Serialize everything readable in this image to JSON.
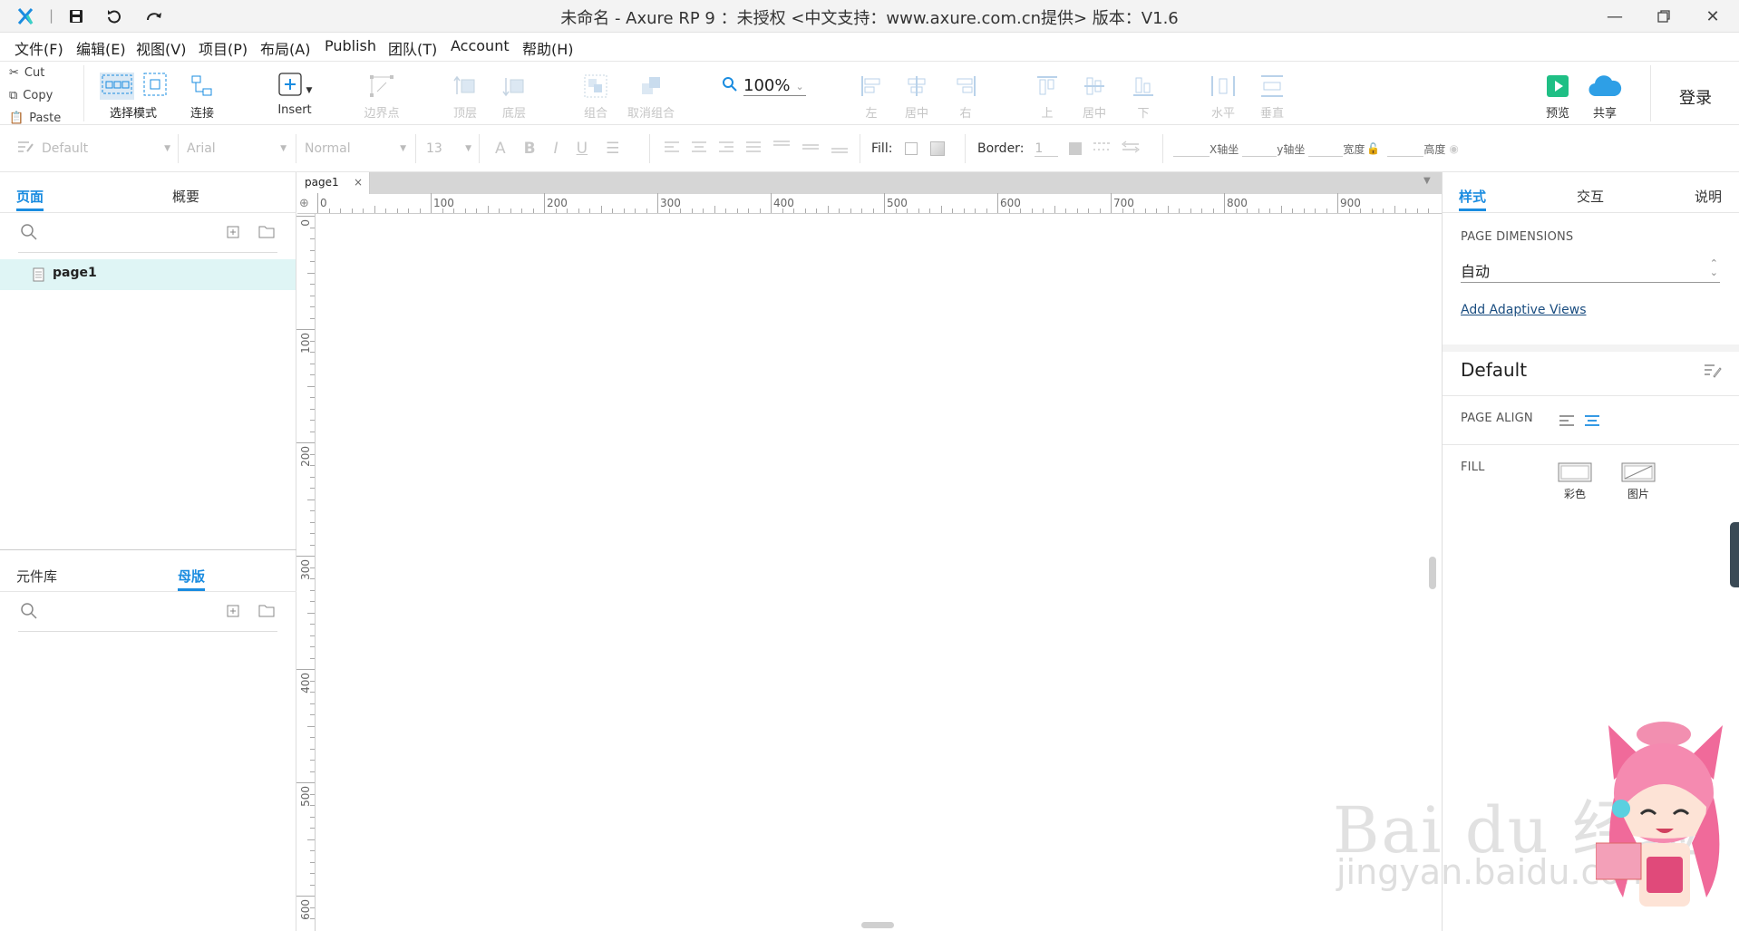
{
  "title_bar": {
    "title": "未命名 - Axure RP 9 ：未授权   <中文支持：www.axure.com.cn提供> 版本：V1.6",
    "separator": "|"
  },
  "menu": [
    "文件(F)",
    "编辑(E)",
    "视图(V)",
    "项目(P)",
    "布局(A)",
    "Publish",
    "团队(T)",
    "Account",
    "帮助(H)"
  ],
  "clipboard": {
    "cut": "Cut",
    "copy": "Copy",
    "paste": "Paste"
  },
  "toolbar": {
    "select_mode": "选择模式",
    "connect": "连接",
    "insert": "Insert",
    "points": "边界点",
    "top_layer": "顶层",
    "bottom_layer": "底层",
    "group": "组合",
    "ungroup": "取消组合",
    "zoom": "100%",
    "align_left": "左",
    "align_center": "居中",
    "align_right": "右",
    "align_top": "上",
    "align_middle": "居中",
    "align_bottom": "下",
    "distribute_h": "水平",
    "distribute_v": "垂直",
    "preview": "预览",
    "share": "共享",
    "login": "登录"
  },
  "format_bar": {
    "style": "Default",
    "font": "Arial",
    "weight": "Normal",
    "size": "13",
    "fill_label": "Fill:",
    "border_label": "Border:",
    "border_value": "1",
    "x_label": "X轴坐",
    "y_label": "y轴坐",
    "w_label": "宽度",
    "h_label": "高度"
  },
  "left_panel": {
    "tabs": [
      "页面",
      "概要"
    ],
    "pages": [
      "page1"
    ],
    "bottom_tabs": [
      "元件库",
      "母版"
    ]
  },
  "canvas": {
    "tab": "page1",
    "h_ticks": [
      "0",
      "100",
      "200",
      "300",
      "400",
      "500",
      "600",
      "700",
      "800",
      "900"
    ],
    "v_ticks": [
      "0",
      "100",
      "200",
      "300",
      "400",
      "500",
      "600"
    ]
  },
  "right_panel": {
    "tabs": [
      "样式",
      "交互",
      "说明"
    ],
    "page_dimensions_label": "PAGE DIMENSIONS",
    "page_dimensions_value": "自动",
    "adaptive_link": "Add Adaptive Views",
    "style_name": "Default",
    "page_align_label": "PAGE ALIGN",
    "fill_label": "FILL",
    "fill_color": "彩色",
    "fill_image": "图片"
  },
  "watermark": {
    "brand": "Bai du 经验",
    "url": "jingyan.baidu.com"
  },
  "colors": {
    "accent": "#1a8ce0",
    "preview_green": "#1fbf85",
    "share_blue": "#2e9fe6",
    "disabled": "#c5c5c5",
    "selected_row": "#dff5f5"
  }
}
